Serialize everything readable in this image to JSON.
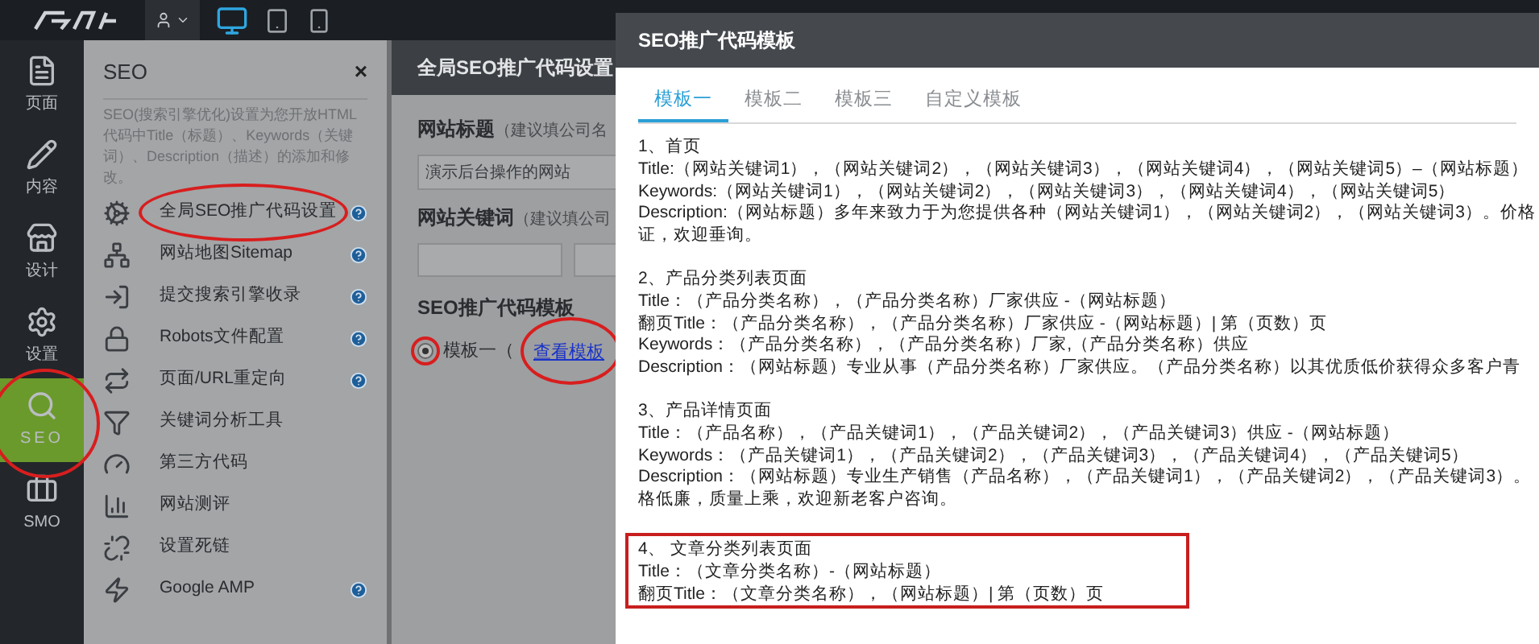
{
  "topbar": {
    "devices": [
      {
        "selected": true
      },
      {
        "selected": false
      },
      {
        "selected": false
      }
    ]
  },
  "sidebar": {
    "items": [
      {
        "label": "页面",
        "selected": false,
        "circled": false
      },
      {
        "label": "内容",
        "selected": false,
        "circled": false
      },
      {
        "label": "设计",
        "selected": false,
        "circled": false
      },
      {
        "label": "设置",
        "selected": false,
        "circled": false
      },
      {
        "label": "SEO",
        "selected": true,
        "circled": true
      },
      {
        "label": "SMO",
        "selected": false,
        "circled": false
      }
    ]
  },
  "seo_panel": {
    "title": "SEO",
    "close": "×",
    "description": "SEO(搜索引擎优化)设置为您开放HTML代码中Title（标题）、Keywords（关键词）、Description（描述）的添加和修改。",
    "items": [
      {
        "label": "全局SEO推广代码设置",
        "help": true,
        "circled": true
      },
      {
        "label": "网站地图Sitemap",
        "help": true,
        "circled": false
      },
      {
        "label": "提交搜索引擎收录",
        "help": true,
        "circled": false
      },
      {
        "label": "Robots文件配置",
        "help": true,
        "circled": false
      },
      {
        "label": "页面/URL重定向",
        "help": true,
        "circled": false
      },
      {
        "label": "关键词分析工具",
        "help": false,
        "circled": false
      },
      {
        "label": "第三方代码",
        "help": false,
        "circled": false
      },
      {
        "label": "网站测评",
        "help": false,
        "circled": false
      },
      {
        "label": "设置死链",
        "help": false,
        "circled": false
      },
      {
        "label": "Google AMP",
        "help": true,
        "circled": false
      }
    ]
  },
  "settings_panel": {
    "title": "全局SEO推广代码设置",
    "site_title": {
      "label": "网站标题",
      "hint": "（建议填公司名",
      "value": "演示后台操作的网站"
    },
    "site_keywords": {
      "label": "网站关键词",
      "hint": "（建议填公司"
    },
    "template": {
      "label": "SEO推广代码模板",
      "option": {
        "label": "模板一（",
        "checked": true,
        "circled": true
      },
      "link": {
        "label": "查看模板",
        "circled": true
      }
    }
  },
  "modal": {
    "title": "SEO推广代码模板",
    "tabs": [
      {
        "label": "模板一",
        "selected": true
      },
      {
        "label": "模板二",
        "selected": false
      },
      {
        "label": "模板三",
        "selected": false
      },
      {
        "label": "自定义模板",
        "selected": false
      }
    ],
    "sections": [
      {
        "highlighted": false,
        "lines": [
          "1、首页",
          "Title:（网站关键词1），（网站关键词2），（网站关键词3），（网站关键词4），（网站关键词5）–（网站标题）",
          "Keywords:（网站关键词1），（网站关键词2），（网站关键词3），（网站关键词4），（网站关键词5）",
          "Description:（网站标题）多年来致力于为您提供各种（网站关键词1），（网站关键词2），（网站关键词3）。价格",
          "证，欢迎垂询。"
        ]
      },
      {
        "highlighted": false,
        "lines": [
          "2、产品分类列表页面",
          "Title：（产品分类名称），（产品分类名称）厂家供应 -（网站标题）",
          "翻页Title：（产品分类名称），（产品分类名称）厂家供应 -（网站标题）| 第（页数）页",
          "Keywords：（产品分类名称），（产品分类名称）厂家,（产品分类名称）供应",
          "Description：（网站标题）专业从事（产品分类名称）厂家供应。（产品分类名称）以其优质低价获得众多客户青"
        ]
      },
      {
        "highlighted": false,
        "lines": [
          "3、产品详情页面",
          "Title：（产品名称），（产品关键词1），（产品关键词2），（产品关键词3）供应 -（网站标题）",
          "Keywords：（产品关键词1），（产品关键词2），（产品关键词3），（产品关键词4），（产品关键词5）",
          "Description：（网站标题）专业生产销售（产品名称），（产品关键词1），（产品关键词2），（产品关键词3）。",
          "格低廉，质量上乘，欢迎新老客户咨询。"
        ]
      },
      {
        "highlighted": true,
        "lines": [
          "4、 文章分类列表页面",
          "Title：（文章分类名称）-（网站标题）",
          "翻页Title：（文章分类名称），（网站标题）| 第（页数）页"
        ]
      }
    ]
  }
}
